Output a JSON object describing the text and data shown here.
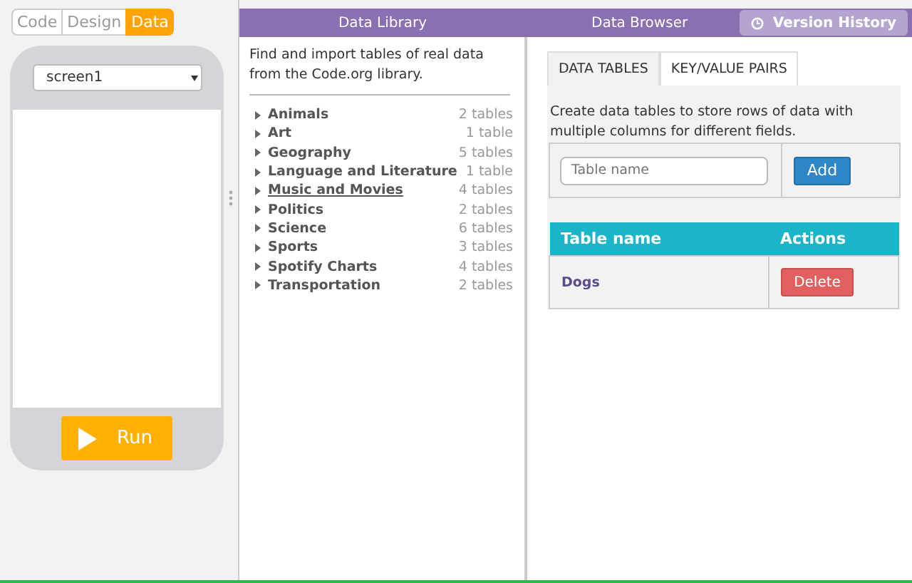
{
  "mode_tabs": [
    {
      "label": "Code",
      "selected": false
    },
    {
      "label": "Design",
      "selected": false
    },
    {
      "label": "Data",
      "selected": true
    }
  ],
  "screen_select": {
    "value": "screen1"
  },
  "run_button": {
    "label": "Run"
  },
  "data_library": {
    "title": "Data Library",
    "intro": "Find and import tables of real data from the Code.org library.",
    "categories": [
      {
        "name": "Animals",
        "count": "2 tables",
        "hovered": false
      },
      {
        "name": "Art",
        "count": "1 table",
        "hovered": false
      },
      {
        "name": "Geography",
        "count": "5 tables",
        "hovered": false
      },
      {
        "name": "Language and Literature",
        "count": "1 table",
        "hovered": false
      },
      {
        "name": "Music and Movies",
        "count": "4 tables",
        "hovered": true
      },
      {
        "name": "Politics",
        "count": "2 tables",
        "hovered": false
      },
      {
        "name": "Science",
        "count": "6 tables",
        "hovered": false
      },
      {
        "name": "Sports",
        "count": "3 tables",
        "hovered": false
      },
      {
        "name": "Spotify Charts",
        "count": "4 tables",
        "hovered": false
      },
      {
        "name": "Transportation",
        "count": "2 tables",
        "hovered": false
      }
    ]
  },
  "data_browser": {
    "title": "Data Browser",
    "version_history": "Version History",
    "tabs": [
      {
        "label": "DATA TABLES",
        "selected": true
      },
      {
        "label": "KEY/VALUE PAIRS",
        "selected": false
      }
    ],
    "intro": "Create data tables to store rows of data with multiple columns for different fields.",
    "new_table": {
      "placeholder": "Table name",
      "button": "Add"
    },
    "table": {
      "columns": [
        "Table name",
        "Actions"
      ],
      "rows": [
        {
          "name": "Dogs",
          "action": "Delete"
        }
      ]
    }
  }
}
